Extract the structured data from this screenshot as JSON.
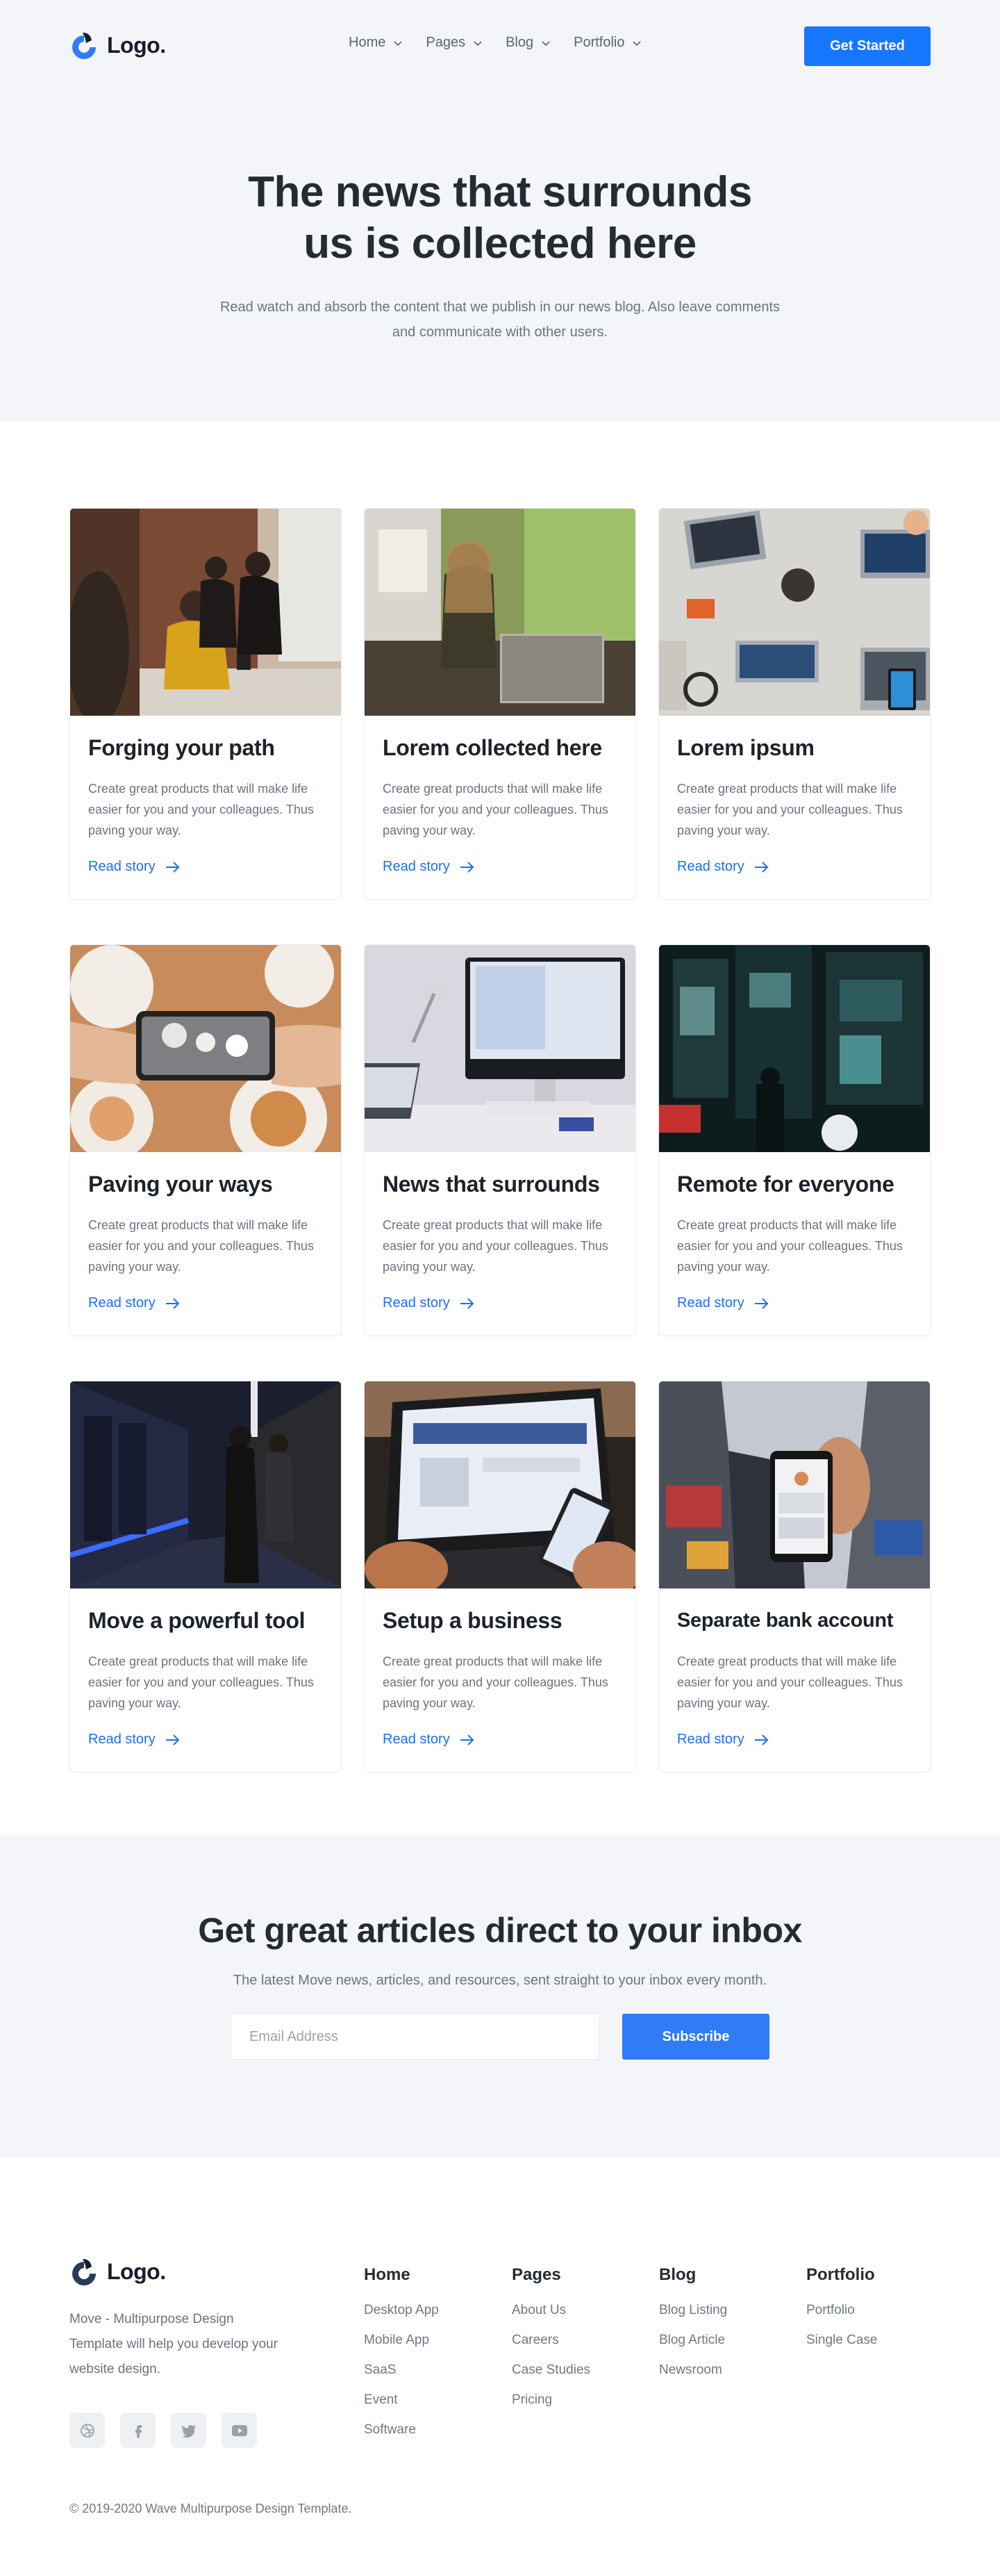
{
  "brand": {
    "name": "Logo.",
    "accent": "#1677ff"
  },
  "nav": {
    "items": [
      {
        "label": "Home"
      },
      {
        "label": "Pages"
      },
      {
        "label": "Blog"
      },
      {
        "label": "Portfolio"
      }
    ],
    "cta_label": "Get Started"
  },
  "hero": {
    "title_line1": "The news that surrounds",
    "title_line2": "us is collected here",
    "subtitle": "Read watch and absorb the content that we publish in our news blog. Also leave comments and communicate with other users."
  },
  "cards": [
    {
      "title": "Forging your path",
      "text": "Create great products that will make life easier for you and your colleagues. Thus paving your way.",
      "link": "Read story",
      "image": "people-cafe-photo"
    },
    {
      "title": "Lorem collected here",
      "text": "Create great products that will make life easier for you and your colleagues. Thus paving your way.",
      "link": "Read story",
      "image": "woman-laptop-photo"
    },
    {
      "title": "Lorem ipsum",
      "text": "Create great products that will make life easier for you and your colleagues. Thus paving your way.",
      "link": "Read story",
      "image": "desk-laptops-photo"
    },
    {
      "title": "Paving your ways",
      "text": "Create great products that will make life easier for you and your colleagues. Thus paving your way.",
      "link": "Read story",
      "image": "food-phone-photo"
    },
    {
      "title": "News that surrounds",
      "text": "Create great products that will make life easier for you and your colleagues. Thus paving your way.",
      "link": "Read story",
      "image": "imac-desk-photo"
    },
    {
      "title": "Remote for everyone",
      "text": "Create great products that will make life easier for you and your colleagues. Thus paving your way.",
      "link": "Read story",
      "image": "city-night-photo"
    },
    {
      "title": "Move a powerful tool",
      "text": "Create great products that will make life easier for you and your colleagues. Thus paving your way.",
      "link": "Read story",
      "image": "server-room-photo"
    },
    {
      "title": "Setup a business",
      "text": "Create great products that will make life easier for you and your colleagues. Thus paving your way.",
      "link": "Read story",
      "image": "laptop-phone-photo"
    },
    {
      "title": "Separate bank account",
      "text": "Create great products that will make life easier for you and your colleagues. Thus paving your way.",
      "link": "Read story",
      "image": "phone-city-photo"
    }
  ],
  "newsletter": {
    "title": "Get great articles direct to your inbox",
    "subtitle": "The latest Move news, articles, and resources, sent straight to your inbox every month.",
    "input_placeholder": "Email Address",
    "button_label": "Subscribe"
  },
  "footer": {
    "description": "Move - Multipurpose Design Template will help you develop your website design.",
    "socials": [
      "dribbble-icon",
      "facebook-icon",
      "twitter-icon",
      "youtube-icon"
    ],
    "columns": [
      {
        "title": "Home",
        "links": [
          "Desktop App",
          "Mobile App",
          "SaaS",
          "Event",
          "Software"
        ]
      },
      {
        "title": "Pages",
        "links": [
          "About Us",
          "Careers",
          "Case Studies",
          "Pricing"
        ]
      },
      {
        "title": "Blog",
        "links": [
          "Blog Listing",
          "Blog Article",
          "Newsroom"
        ]
      },
      {
        "title": "Portfolio",
        "links": [
          "Portfolio",
          "Single Case"
        ]
      }
    ],
    "copyright": "© 2019-2020 Wave Multipurpose Design Template."
  }
}
